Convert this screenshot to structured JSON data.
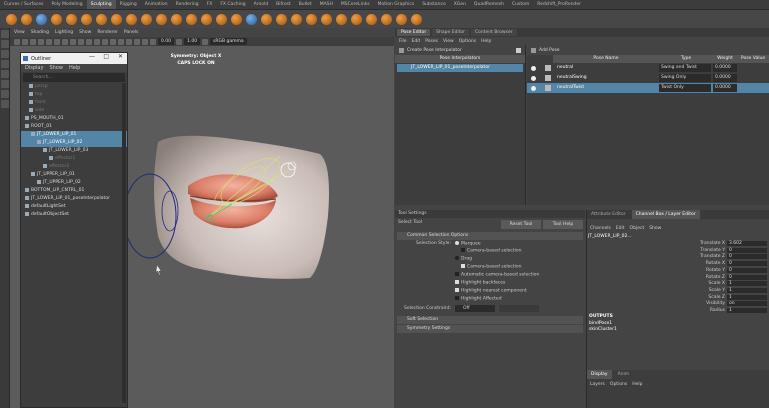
{
  "shelf": {
    "tabs": [
      "Curves / Surfaces",
      "Poly Modeling",
      "Sculpting",
      "Rigging",
      "Animation",
      "Rendering",
      "FX",
      "FX Caching",
      "Arnold",
      "Bifrost",
      "Bullet",
      "MASH",
      "MSCoreLinks",
      "Motion Graphics",
      "Substance",
      "XGen",
      "QuadRemesh",
      "Custom",
      "Redshift_ProRender"
    ],
    "active_tab": "Sculpting"
  },
  "viewport": {
    "menu": [
      "View",
      "Shading",
      "Lighting",
      "Show",
      "Renderer",
      "Panels"
    ],
    "num_a": "0.00",
    "num_b": "1.00",
    "color_space": "sRGB gamma",
    "symmetry_label": "Symmetry: Object X",
    "caps_lock_label": "CAPS LOCK ON"
  },
  "outliner": {
    "title": "Outliner",
    "menu": [
      "Display",
      "Show",
      "Help"
    ],
    "search_placeholder": "Search...",
    "items": [
      {
        "label": "persp",
        "dim": true
      },
      {
        "label": "top",
        "dim": true
      },
      {
        "label": "front",
        "dim": true
      },
      {
        "label": "side",
        "dim": true
      },
      {
        "label": "PS_MOUTH_01",
        "dim": false
      },
      {
        "label": "ROOT_01",
        "dim": false
      },
      {
        "label": "JT_LOWER_LIP_01",
        "dim": false,
        "selected": true
      },
      {
        "label": "JT_LOWER_LIP_02",
        "dim": false,
        "selected": true
      },
      {
        "label": "JT_LOWER_LIP_03",
        "dim": false
      },
      {
        "label": "effector1",
        "dim": true
      },
      {
        "label": "effector2",
        "dim": true
      },
      {
        "label": "JT_UPPER_LIP_01",
        "dim": false
      },
      {
        "label": "JT_UPPER_LIP_02",
        "dim": false
      },
      {
        "label": "BOTTOM_LIP_CNTRL_01",
        "dim": false
      },
      {
        "label": "JT_LOWER_LIP_01_poseInterpolator",
        "dim": false
      },
      {
        "label": "defaultLightSet",
        "dim": false
      },
      {
        "label": "defaultObjectSet",
        "dim": false
      }
    ]
  },
  "pose_editor": {
    "tabs": [
      "Pose Editor",
      "Shape Editor",
      "Content Browser"
    ],
    "menu": [
      "File",
      "Edit",
      "Poses",
      "View",
      "Options",
      "Help"
    ],
    "create_interpolator": "Create Pose Interpolator",
    "interpolators_header": "Pose Interpolators",
    "interpolator_item": "JT_LOWER_LIP_01_poseInterpolator",
    "add_pose": "Add Pose",
    "columns": [
      "Pose Name",
      "Type",
      "Weight",
      "Pose Value"
    ],
    "poses": [
      {
        "name": "neutral",
        "type": "Swing and Twist",
        "weight": "0.0000",
        "selected": false
      },
      {
        "name": "neutralSwing",
        "type": "Swing Only",
        "weight": "0.0000",
        "selected": false
      },
      {
        "name": "neutralTwist",
        "type": "Twist Only",
        "weight": "0.0000",
        "selected": true
      }
    ]
  },
  "tool_settings": {
    "title": "Tool Settings",
    "tool_name": "Select Tool",
    "reset_btn": "Reset Tool",
    "help_btn": "Tool Help",
    "common_section": "Common Selection Options",
    "selection_style_label": "Selection Style:",
    "marquee": "Marquee",
    "camera_based_1": "Camera-based selection",
    "drag": "Drag",
    "camera_based_2": "Camera-based selection",
    "auto_camera": "Automatic camera-based selection",
    "highlight_backfaces": "Highlight backfaces",
    "highlight_nearest": "Highlight nearest component",
    "highlight_affected": "Highlight Affected",
    "constraint_label": "Selection Constraint:",
    "constraint_value": "Off",
    "soft_section": "Soft Selection",
    "symmetry_section": "Symmetry Settings"
  },
  "channel_box": {
    "tabs": [
      "Attribute Editor",
      "Channel Box / Layer Editor"
    ],
    "menu": [
      "Channels",
      "Edit",
      "Object",
      "Show"
    ],
    "object_name": "JT_LOWER_LIP_02...",
    "attributes": [
      {
        "name": "Translate X",
        "value": "3.602"
      },
      {
        "name": "Translate Y",
        "value": "0"
      },
      {
        "name": "Translate Z",
        "value": "0"
      },
      {
        "name": "Rotate X",
        "value": "0"
      },
      {
        "name": "Rotate Y",
        "value": "0"
      },
      {
        "name": "Rotate Z",
        "value": "0"
      },
      {
        "name": "Scale X",
        "value": "1"
      },
      {
        "name": "Scale Y",
        "value": "1"
      },
      {
        "name": "Scale Z",
        "value": "1"
      },
      {
        "name": "Visibility",
        "value": "on"
      },
      {
        "name": "Radius",
        "value": "1"
      }
    ],
    "outputs_label": "OUTPUTS",
    "outputs": [
      "bindPose1",
      "skinCluster1"
    ],
    "layer_tabs": [
      "Display",
      "Anim"
    ],
    "layer_menu": [
      "Layers",
      "Options",
      "Help"
    ]
  }
}
